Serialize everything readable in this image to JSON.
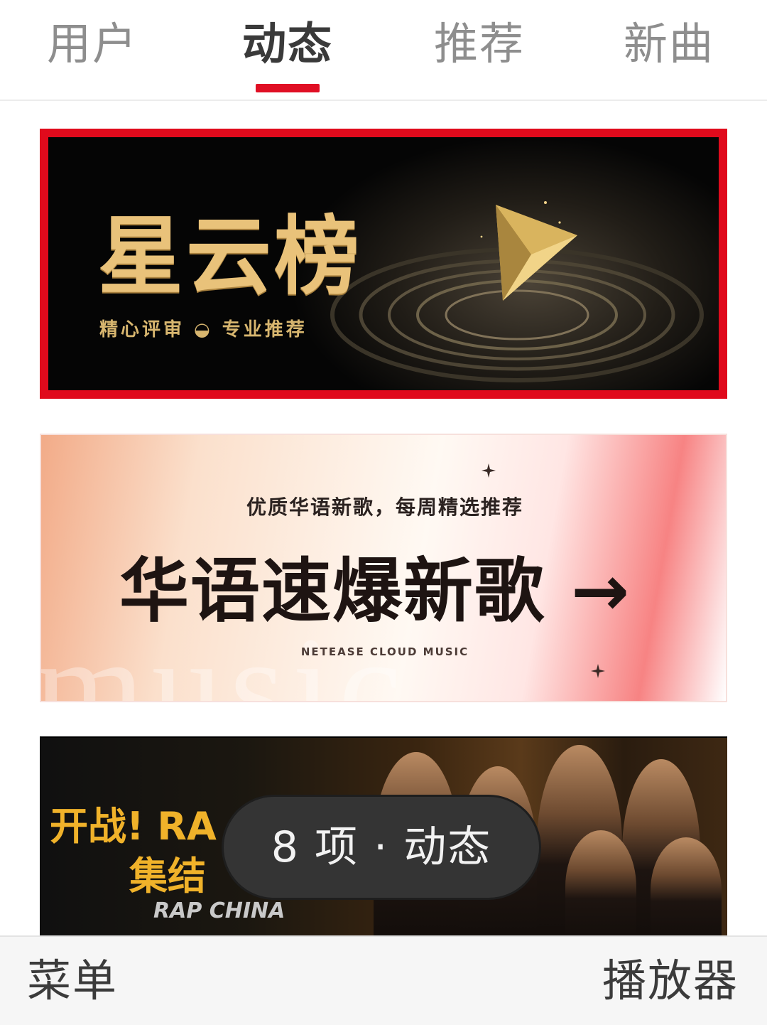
{
  "tabs": [
    {
      "label": "用户",
      "active": false
    },
    {
      "label": "动态",
      "active": true
    },
    {
      "label": "推荐",
      "active": false
    },
    {
      "label": "新曲",
      "active": false
    }
  ],
  "accent_color": "#e00f24",
  "banners": [
    {
      "title": "星云榜",
      "subtitle": "精心评审 ◒ 专业推荐",
      "selected": true
    },
    {
      "subtitle": "优质华语新歌，每周精选推荐",
      "title": "华语速爆新歌 →",
      "brand": "NETEASE CLOUD MUSIC",
      "watermark": "music"
    },
    {
      "text_line1": "开战! RA",
      "text_line2": "集结",
      "logo": "RAP CHINA"
    }
  ],
  "toast": {
    "text": "8 项 · 动态"
  },
  "bottom_bar": {
    "menu_label": "菜单",
    "player_label": "播放器"
  }
}
